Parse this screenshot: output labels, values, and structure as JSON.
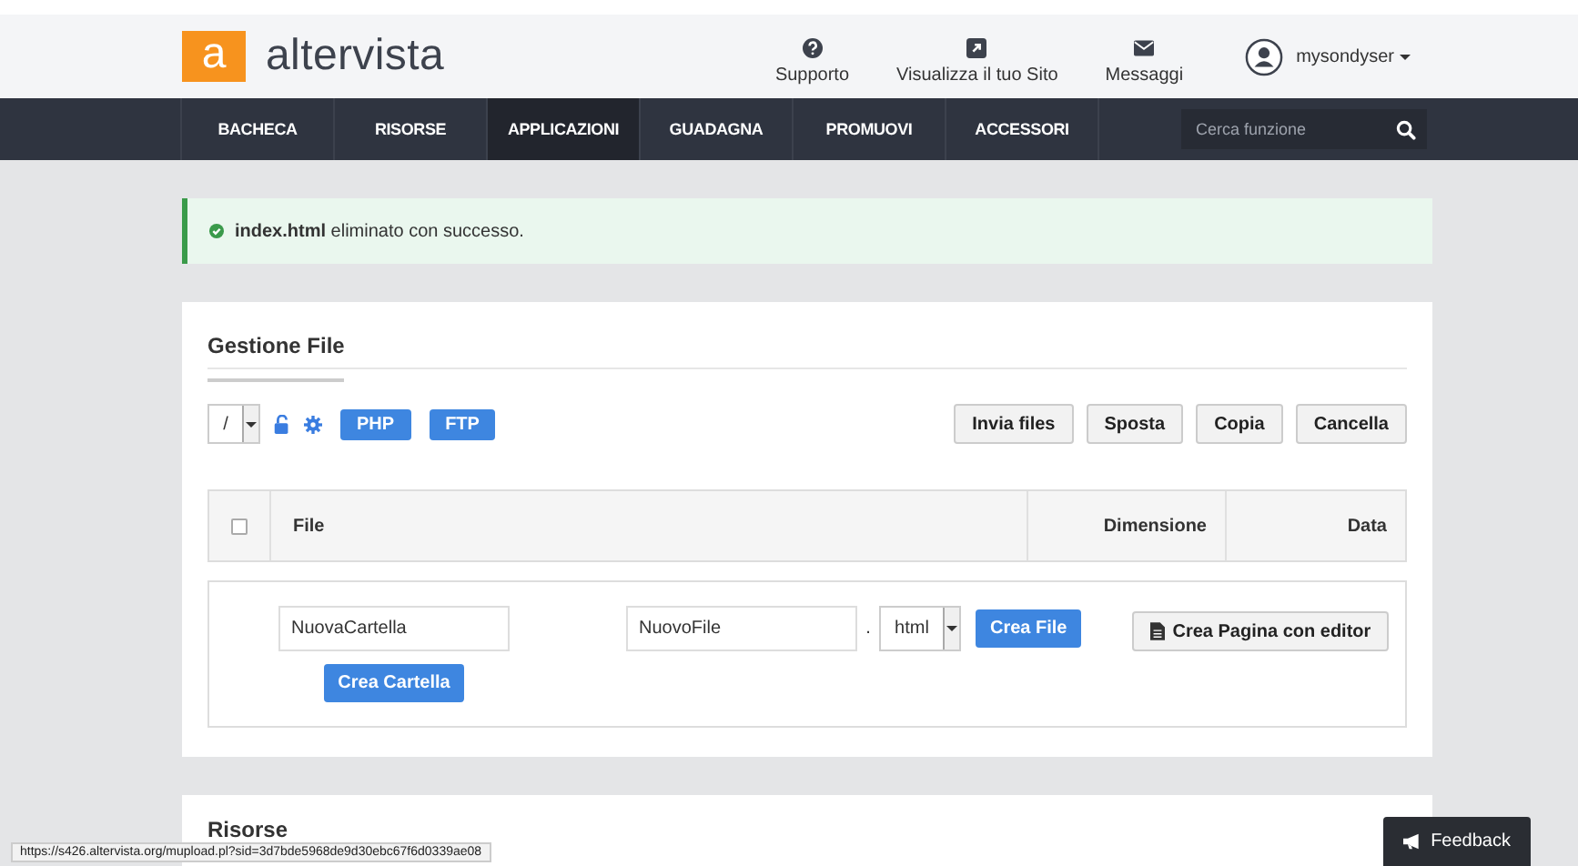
{
  "header": {
    "logo_letter": "a",
    "logo_text": "altervista",
    "links": [
      "Supporto",
      "Visualizza il tuo Sito",
      "Messaggi"
    ],
    "user": "mysondyser"
  },
  "nav": {
    "items": [
      {
        "label": "BACHECA",
        "selected": false
      },
      {
        "label": "RISORSE",
        "selected": false
      },
      {
        "label": "APPLICAZIONI",
        "selected": true
      },
      {
        "label": "GUADAGNA",
        "selected": false
      },
      {
        "label": "PROMUOVI",
        "selected": false
      },
      {
        "label": "ACCESSORI",
        "selected": false
      }
    ],
    "search_placeholder": "Cerca funzione"
  },
  "alert": "**index.html** eliminato con successo.",
  "file_manager": {
    "title": "Gestione File",
    "path": "/",
    "mode_buttons": [
      "PHP",
      "FTP"
    ],
    "actions": [
      "Invia files",
      "Sposta",
      "Copia",
      "Cancella"
    ],
    "table": {
      "select_all": {
        "checked": false
      },
      "columns": [
        "File",
        "Dimensione",
        "Data"
      ]
    },
    "create": {
      "folder_value": "NuovaCartella",
      "folder_button": "Crea Cartella",
      "file_value": "NuovoFile",
      "dot": ".",
      "extension": "html",
      "file_button": "Crea File",
      "editor_button": "Crea Pagina con editor"
    }
  },
  "resources_title": "Risorse",
  "status_url": "https://s426.altervista.org/mupload.pl?sid=3d7bde5968de9d30ebc67f6d0339ae08",
  "feedback": "Feedback"
}
